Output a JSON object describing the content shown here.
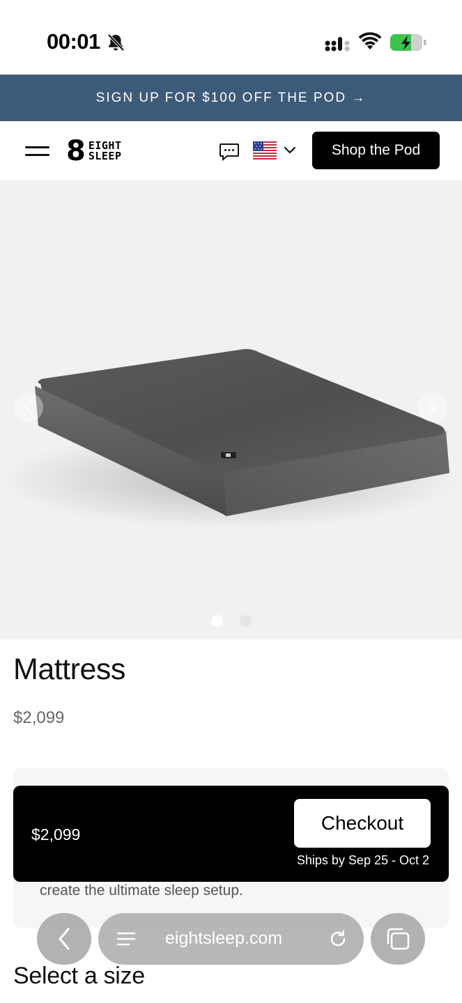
{
  "status_bar": {
    "time": "00:01",
    "icons": [
      "bell-slash-icon",
      "signal-icon",
      "wifi-icon",
      "battery-charging-icon"
    ]
  },
  "promo_banner": {
    "text": "SIGN UP FOR $100 OFF THE POD →",
    "background": "#3e5a79"
  },
  "nav": {
    "logo_words": [
      "EIGHT",
      "SLEEP"
    ],
    "logo_mark": "8",
    "shop_button": "Shop the Pod",
    "icons": [
      "menu-icon",
      "chat-icon",
      "us-flag-icon",
      "chevron-down-icon"
    ]
  },
  "carousel": {
    "slide_count": 2,
    "active_index": 0
  },
  "product": {
    "title": "Mattress",
    "price": "$2,099"
  },
  "info_card": {
    "text_fragment": "create the ultimate sleep setup."
  },
  "checkout_bar": {
    "price": "$2,099",
    "button_label": "Checkout",
    "shipping": "Ships by Sep 25 - Oct 2"
  },
  "section": {
    "select_size": "Select a size"
  },
  "browser": {
    "url": "eightsleep.com"
  }
}
